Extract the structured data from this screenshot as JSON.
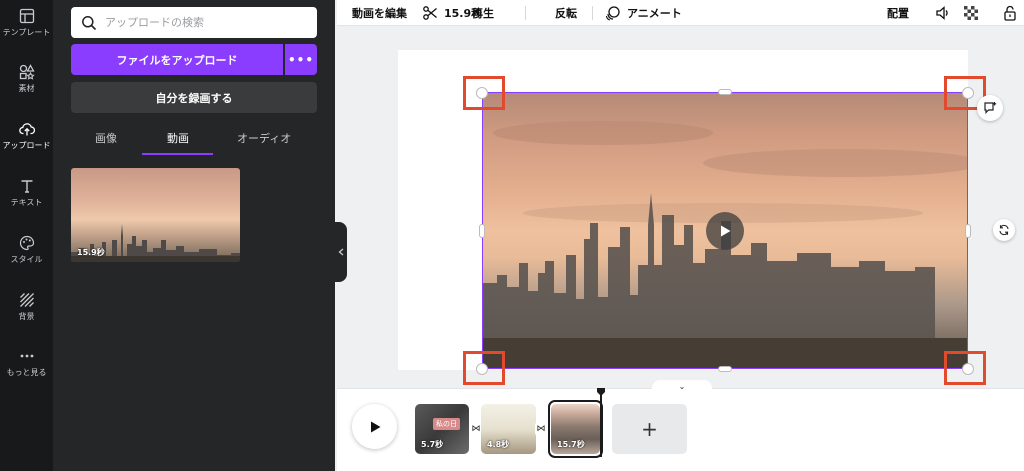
{
  "rail": {
    "items": [
      {
        "label": "テンプレート",
        "icon": "template-icon"
      },
      {
        "label": "素材",
        "icon": "elements-icon"
      },
      {
        "label": "アップロード",
        "icon": "cloud-upload-icon"
      },
      {
        "label": "テキスト",
        "icon": "text-icon"
      },
      {
        "label": "スタイル",
        "icon": "palette-icon"
      },
      {
        "label": "背景",
        "icon": "background-icon"
      },
      {
        "label": "もっと見る",
        "icon": "more-icon"
      }
    ],
    "active_index": 2
  },
  "panel": {
    "search_placeholder": "アップロードの検索",
    "upload_button": "ファイルをアップロード",
    "more_button": "•••",
    "record_button": "自分を録画する",
    "tabs": [
      "画像",
      "動画",
      "オーディオ"
    ],
    "active_tab": 1,
    "media": [
      {
        "duration": "15.9秒"
      }
    ]
  },
  "toolbar": {
    "edit_video": "動画を編集",
    "trim_duration": "15.9秒",
    "playback": "再生",
    "flip": "反転",
    "animate": "アニメート",
    "arrange": "配置"
  },
  "timeline": {
    "clips": [
      {
        "duration": "5.7秒",
        "thumb_text": "私の日"
      },
      {
        "duration": "4.8秒"
      },
      {
        "duration": "15.7秒"
      }
    ],
    "selected_clip": 2,
    "add_label": "+",
    "toggle_label": "⌄",
    "transition_symbol": "⋈"
  },
  "colors": {
    "accent": "#8b3dff",
    "highlight_box": "#e14a2c",
    "rail_bg": "#18191b",
    "panel_bg": "#252627"
  }
}
